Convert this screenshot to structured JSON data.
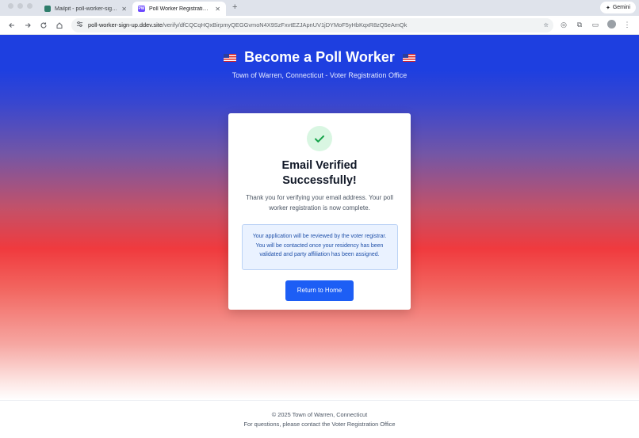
{
  "browser": {
    "tabs": [
      {
        "title": "Mailpit - poll-worker-sign-up",
        "close": "✕"
      },
      {
        "title": "Poll Worker Registration - Wa",
        "close": "✕"
      }
    ],
    "new_tab": "+",
    "gemini_label": "Gemini",
    "url_host": "poll-worker-sign-up.ddev.site",
    "url_path": "/verify/dfCQCqHQxBirpmyQEGGvmoN4X9SzFxvtEZJApnUV1jDYMoF5yHbKqxR8zQ5eAmQk"
  },
  "hero": {
    "title": "Become a Poll Worker",
    "subtitle": "Town of Warren, Connecticut - Voter Registration Office"
  },
  "card": {
    "title": "Email Verified Successfully!",
    "message": "Thank you for verifying your email address. Your poll worker registration is now complete.",
    "info": "Your application will be reviewed by the voter registrar. You will be contacted once your residency has been validated and party affiliation has been assigned.",
    "button_label": "Return to Home"
  },
  "footer": {
    "copyright": "© 2025 Town of Warren, Connecticut",
    "contact": "For questions, please contact the Voter Registration Office"
  },
  "colors": {
    "hero_blue": "#1e3fe0",
    "hero_red": "#f03a3e",
    "button_blue": "#1d5ef5",
    "success_green": "#16a34a"
  }
}
